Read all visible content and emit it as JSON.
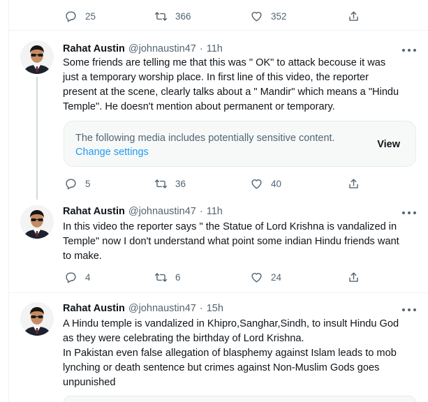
{
  "top_actions": {
    "replies": "25",
    "retweets": "366",
    "likes": "352"
  },
  "tweets": [
    {
      "name": "Rahat Austin",
      "handle": "@johnaustin47",
      "separator": "·",
      "time": "11h",
      "lines": [
        "Some friends are telling me that this was \" OK\" to attack becouse it was",
        "just a temporary worship place. In first line of this video, the reporter",
        "present at the scene, clearly talks about a \" Mandir\" which means a \"Hindu",
        "Temple\". He doesn't mention about permanent or temporary."
      ],
      "media": {
        "warning": "The following media includes potentially sensitive content.",
        "settings_link": "Change settings",
        "view_label": "View"
      },
      "replies": "5",
      "retweets": "36",
      "likes": "40"
    },
    {
      "name": "Rahat Austin",
      "handle": "@johnaustin47",
      "separator": "·",
      "time": "11h",
      "lines": [
        "In this video the reporter says \" the Statue of Lord Krishna is vandalized in",
        "Temple\" now I don't understand what point some indian Hindu friends want",
        "to make."
      ],
      "replies": "4",
      "retweets": "6",
      "likes": "24"
    },
    {
      "name": "Rahat Austin",
      "handle": "@johnaustin47",
      "separator": "·",
      "time": "15h",
      "lines": [
        "A Hindu temple is vandalized in Khipro,Sanghar,Sindh, to insult Hindu God",
        "as they were celebrating the birthday of Lord Krishna.",
        "In Pakistan even false allegation of blasphemy against Islam leads to mob",
        "lynching or death sentence but crimes against Non-Muslim Gods goes",
        "unpunished"
      ]
    }
  ]
}
